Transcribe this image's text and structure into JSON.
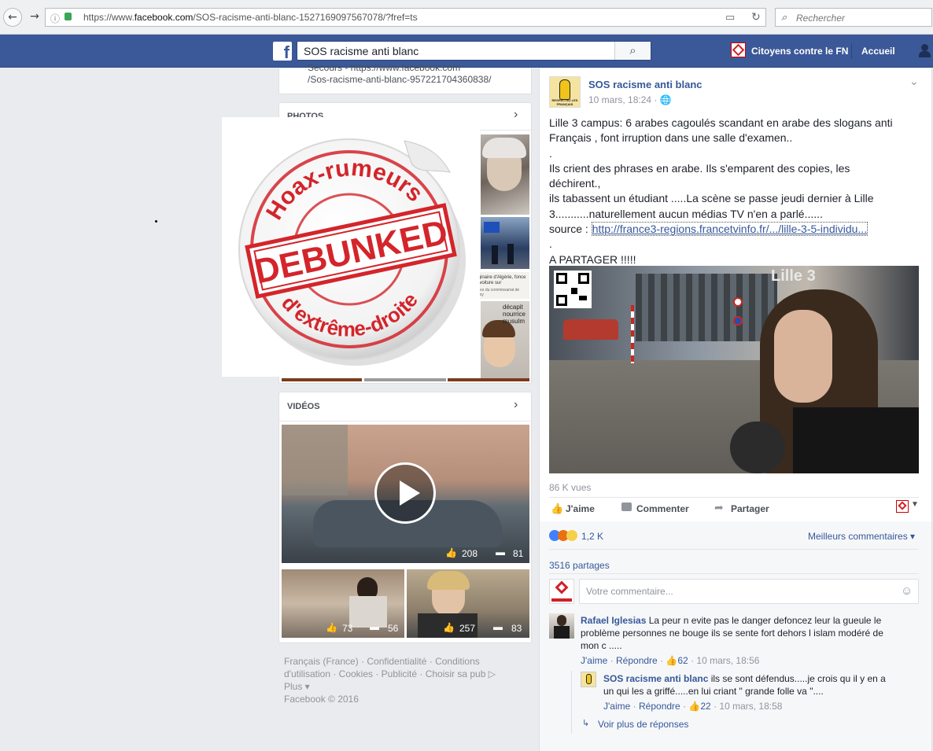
{
  "browser": {
    "url_prefix": "https://www.",
    "url_domain": "facebook.com",
    "url_path": "/SOS-racisme-anti-blanc-1527169097567078/?fref=ts",
    "search_placeholder": "Rechercher"
  },
  "fb": {
    "logo": "f",
    "search_value": "SOS racisme anti blanc",
    "nav_profile": "Citoyens contre le FN",
    "nav_home": "Accueil"
  },
  "left": {
    "about_link_line1": "Secours - https://www.facebook.com",
    "about_link_line2": "/Sos-racisme-anti-blanc-957221704360838/",
    "photos_title": "PHOTOS",
    "photo_caption_1": "originaire d'Algérie, fonce en voiture sur",
    "photo_caption_2": "fidèles du commissariat de Fenoy",
    "photo_caption_3": "décapit nourrice musulm",
    "videos_title": "VIDÉOS",
    "video_main_likes": "208",
    "video_main_comments": "81",
    "video_small1_likes": "73",
    "video_small1_comments": "56",
    "video_small2_likes": "257",
    "video_small2_comments": "83"
  },
  "sticker": {
    "top_arc": "Hoax-rumeurs",
    "center": "DEBUNKED",
    "bottom_arc": "d'extrême-droite"
  },
  "footer": {
    "line1": "Français (France) · Confidentialité · Conditions",
    "line2": "d'utilisation · Cookies · Publicité · Choisir sa pub ▷",
    "line3": "Plus ▾",
    "line4": "Facebook © 2016"
  },
  "post": {
    "page_name": "SOS racisme anti blanc",
    "timestamp": "10 mars, 18:24 · 🌐",
    "avatar_text": "RESPECTEZ LES FRANÇAIS",
    "text_line1": "Lille 3 campus: 6 arabes cagoulés scandant en arabe des slogans anti",
    "text_line2": "Français , font irruption dans une salle d'examen..",
    "text_line3": ".",
    "text_line4": "Ils crient des phrases en arabe. Ils s'emparent des copies, les déchirent.,",
    "text_line5": "ils tabassent un étudiant .....La scène se passe jeudi dernier à Lille",
    "text_line6": "3...........naturellement aucun médias TV n'en a parlé......",
    "text_source_label": "source : ",
    "text_source_link": "http://france3-regions.francetvinfo.fr/.../lille-3-5-individu...",
    "text_line8": ".",
    "text_line9": "A PARTAGER !!!!!",
    "video_sign": "Lille 3",
    "views": "86 K vues",
    "like_label": "J'aime",
    "comment_label": "Commenter",
    "share_label": "Partager",
    "reactions_count": "1,2 K",
    "best_comments": "Meilleurs commentaires ▾",
    "shares": "3516 partages",
    "comment_placeholder": "Votre commentaire..."
  },
  "comments": [
    {
      "author": "Rafael Iglesias",
      "text_start": " La peur n evite pas le danger defoncez leur la gueule le",
      "text_line2": "problème personnes ne bouge ils se sente fort dehors l islam modéré de",
      "text_line3": "mon c .....",
      "like": "J'aime",
      "reply": "Répondre",
      "likes": "62",
      "time": "10 mars, 18:56"
    },
    {
      "author": "SOS racisme anti blanc",
      "text_start": " ils se sont défendus.....je crois qu il y en a",
      "text_line2": "un qui les a griffé.....en lui criant \" grande folle va \"....",
      "like": "J'aime",
      "reply": "Répondre",
      "likes": "22",
      "time": "10 mars, 18:58"
    }
  ],
  "more_replies": "Voir plus de réponses",
  "colors": {
    "facebook_blue": "#3b5998",
    "link_blue": "#365899",
    "sticker_red": "#d3252b",
    "like_blue": "#4080ff",
    "angry_orange": "#e9710f"
  }
}
